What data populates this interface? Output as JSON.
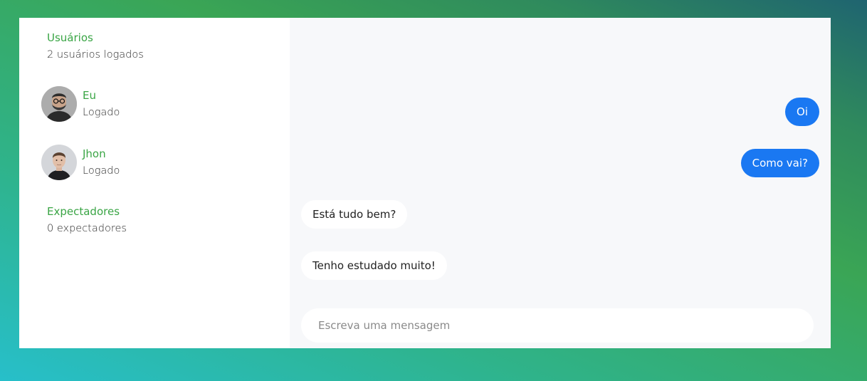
{
  "sidebar": {
    "users": {
      "title": "Usuários",
      "count_text": "2 usuários logados",
      "list": [
        {
          "name": "Eu",
          "status": "Logado",
          "avatar": "bearded-man-avatar"
        },
        {
          "name": "Jhon",
          "status": "Logado",
          "avatar": "young-man-avatar"
        }
      ]
    },
    "spectators": {
      "title": "Expectadores",
      "count_text": "0 expectadores"
    }
  },
  "chat": {
    "messages": [
      {
        "text": "Oi",
        "direction": "sent"
      },
      {
        "text": "Como vai?",
        "direction": "sent"
      },
      {
        "text": "Está tudo bem?",
        "direction": "received"
      },
      {
        "text": "Tenho estudado muito!",
        "direction": "received"
      }
    ],
    "input": {
      "placeholder": "Escreva uma mensagem",
      "value": ""
    }
  },
  "colors": {
    "accent_green": "#3aa545",
    "sent_bubble": "#1a78f2",
    "chat_background": "#f7f8fa"
  }
}
